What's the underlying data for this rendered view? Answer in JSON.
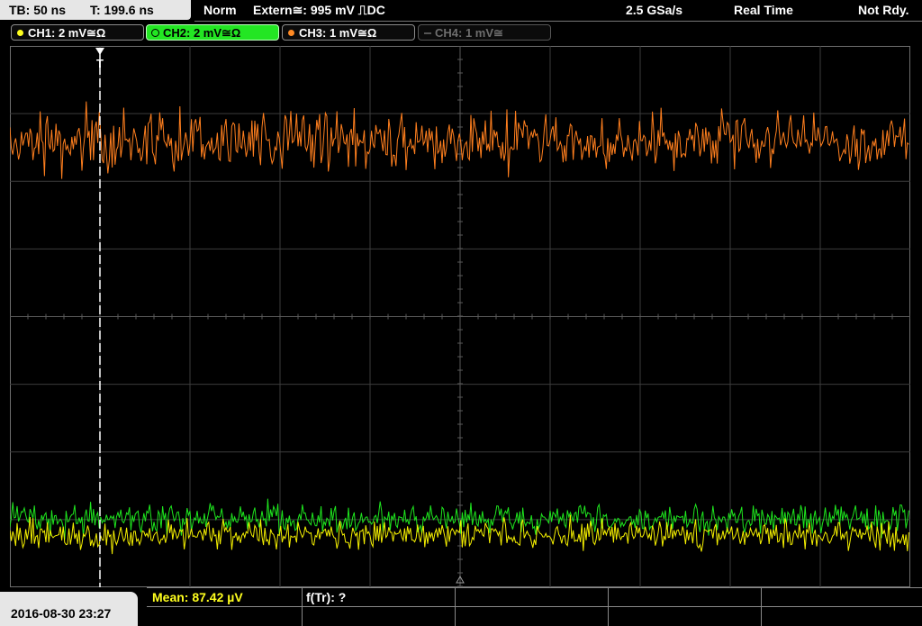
{
  "header": {
    "timebase": "TB: 50 ns",
    "trigger_time": "T: 199.6 ns",
    "trigger_mode": "Norm",
    "trigger_source": "Extern≅: 995 mV ⎍DC",
    "sample_rate": "2.5 GSa/s",
    "acquisition_mode": "Real Time",
    "status": "Not Rdy."
  },
  "channels": [
    {
      "label": "CH1: 2 mV≅Ω",
      "color": "#ffff1e",
      "state": "on"
    },
    {
      "label": "CH2: 2 mV≅Ω",
      "color": "#23e623",
      "state": "selected"
    },
    {
      "label": "CH3: 1 mV≅Ω",
      "color": "#ff8a24",
      "state": "on"
    },
    {
      "label": "CH4: 1 mV≅",
      "color": "#6e6e6e",
      "state": "off"
    }
  ],
  "trigger_marker": "T",
  "traces": {
    "ch3_color": "#ff7f1e",
    "ch2_color": "#1ee61e",
    "ch1_color": "#f5f000"
  },
  "footer": {
    "datetime": "2016-08-30 23:27",
    "mean_label": "Mean: 87.42 µV",
    "ftr_label": "f(Tr): ?"
  }
}
